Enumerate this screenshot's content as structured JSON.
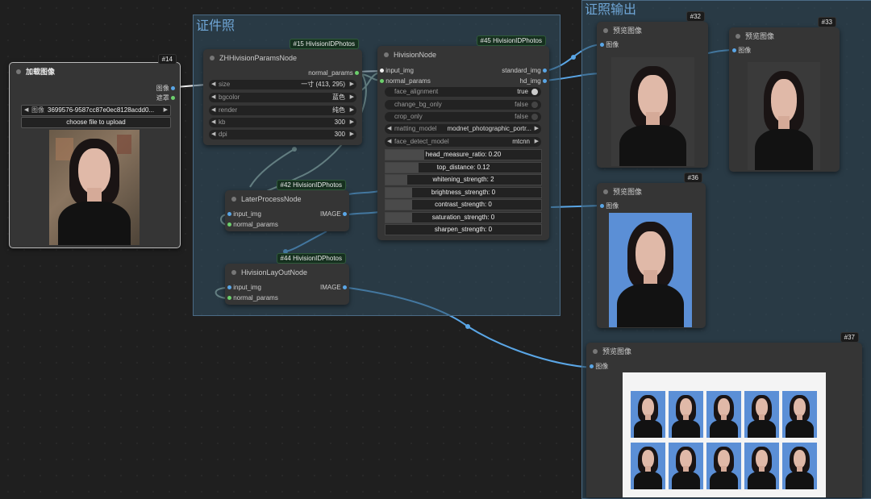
{
  "groups": {
    "left_title": "证件照",
    "right_title": "证照输出"
  },
  "colors": {
    "wire": "#5aa6e6",
    "wire_params": "#9fb7a5",
    "id_blue": "#5b8fd6"
  },
  "nodes": {
    "load_image": {
      "id": "#14",
      "title": "加载图像",
      "out_image": "图像",
      "out_mask": "遮罩",
      "combo_label": "图像",
      "combo_value": "3699576-9587cc87e0ec8128acdd0...",
      "upload_label": "choose file to upload"
    },
    "params": {
      "badge": "#15 HivisionIDPhotos",
      "title": "ZHHivisionParamsNode",
      "out": "normal_params",
      "widgets": [
        {
          "label": "size",
          "value": "一寸 (413, 295)"
        },
        {
          "label": "bgcolor",
          "value": "蓝色"
        },
        {
          "label": "render",
          "value": "纯色"
        },
        {
          "label": "kb",
          "value": "300"
        },
        {
          "label": "dpi",
          "value": "300"
        }
      ]
    },
    "hivision": {
      "badge": "#45 HivisionIDPhotos",
      "title": "HivisionNode",
      "in1": "input_img",
      "in2": "normal_params",
      "out1": "standard_img",
      "out2": "hd_img",
      "toggles": [
        {
          "label": "face_alignment",
          "value": "true"
        },
        {
          "label": "change_bg_only",
          "value": "false"
        },
        {
          "label": "crop_only",
          "value": "false"
        }
      ],
      "combos": [
        {
          "label": "matting_model",
          "value": "modnet_photographic_portr..."
        },
        {
          "label": "face_detect_model",
          "value": "mtcnn"
        }
      ],
      "sliders": [
        {
          "text": "head_measure_ratio: 0.20",
          "fill": 0.25
        },
        {
          "text": "top_distance: 0.12",
          "fill": 0.21
        },
        {
          "text": "whitening_strength: 2",
          "fill": 0.14
        },
        {
          "text": "brightness_strength: 0",
          "fill": 0.17
        },
        {
          "text": "contrast_strength: 0",
          "fill": 0.17
        },
        {
          "text": "saturation_strength: 0",
          "fill": 0.17
        },
        {
          "text": "sharpen_strength: 0",
          "fill": 0.0
        }
      ]
    },
    "later": {
      "badge": "#42 HivisionIDPhotos",
      "title": "LaterProcessNode",
      "in1": "input_img",
      "in2": "normal_params",
      "out": "IMAGE"
    },
    "layout": {
      "badge": "#44 HivisionIDPhotos",
      "title": "HivisionLayOutNode",
      "in1": "input_img",
      "in2": "normal_params",
      "out": "IMAGE"
    },
    "preview32": {
      "id": "#32",
      "title": "预览图像",
      "in": "图像"
    },
    "preview33": {
      "id": "#33",
      "title": "预览图像",
      "in": "图像"
    },
    "preview36": {
      "id": "#36",
      "title": "预览图像",
      "in": "图像"
    },
    "preview37": {
      "id": "#37",
      "title": "预览图像",
      "in": "图像"
    }
  }
}
